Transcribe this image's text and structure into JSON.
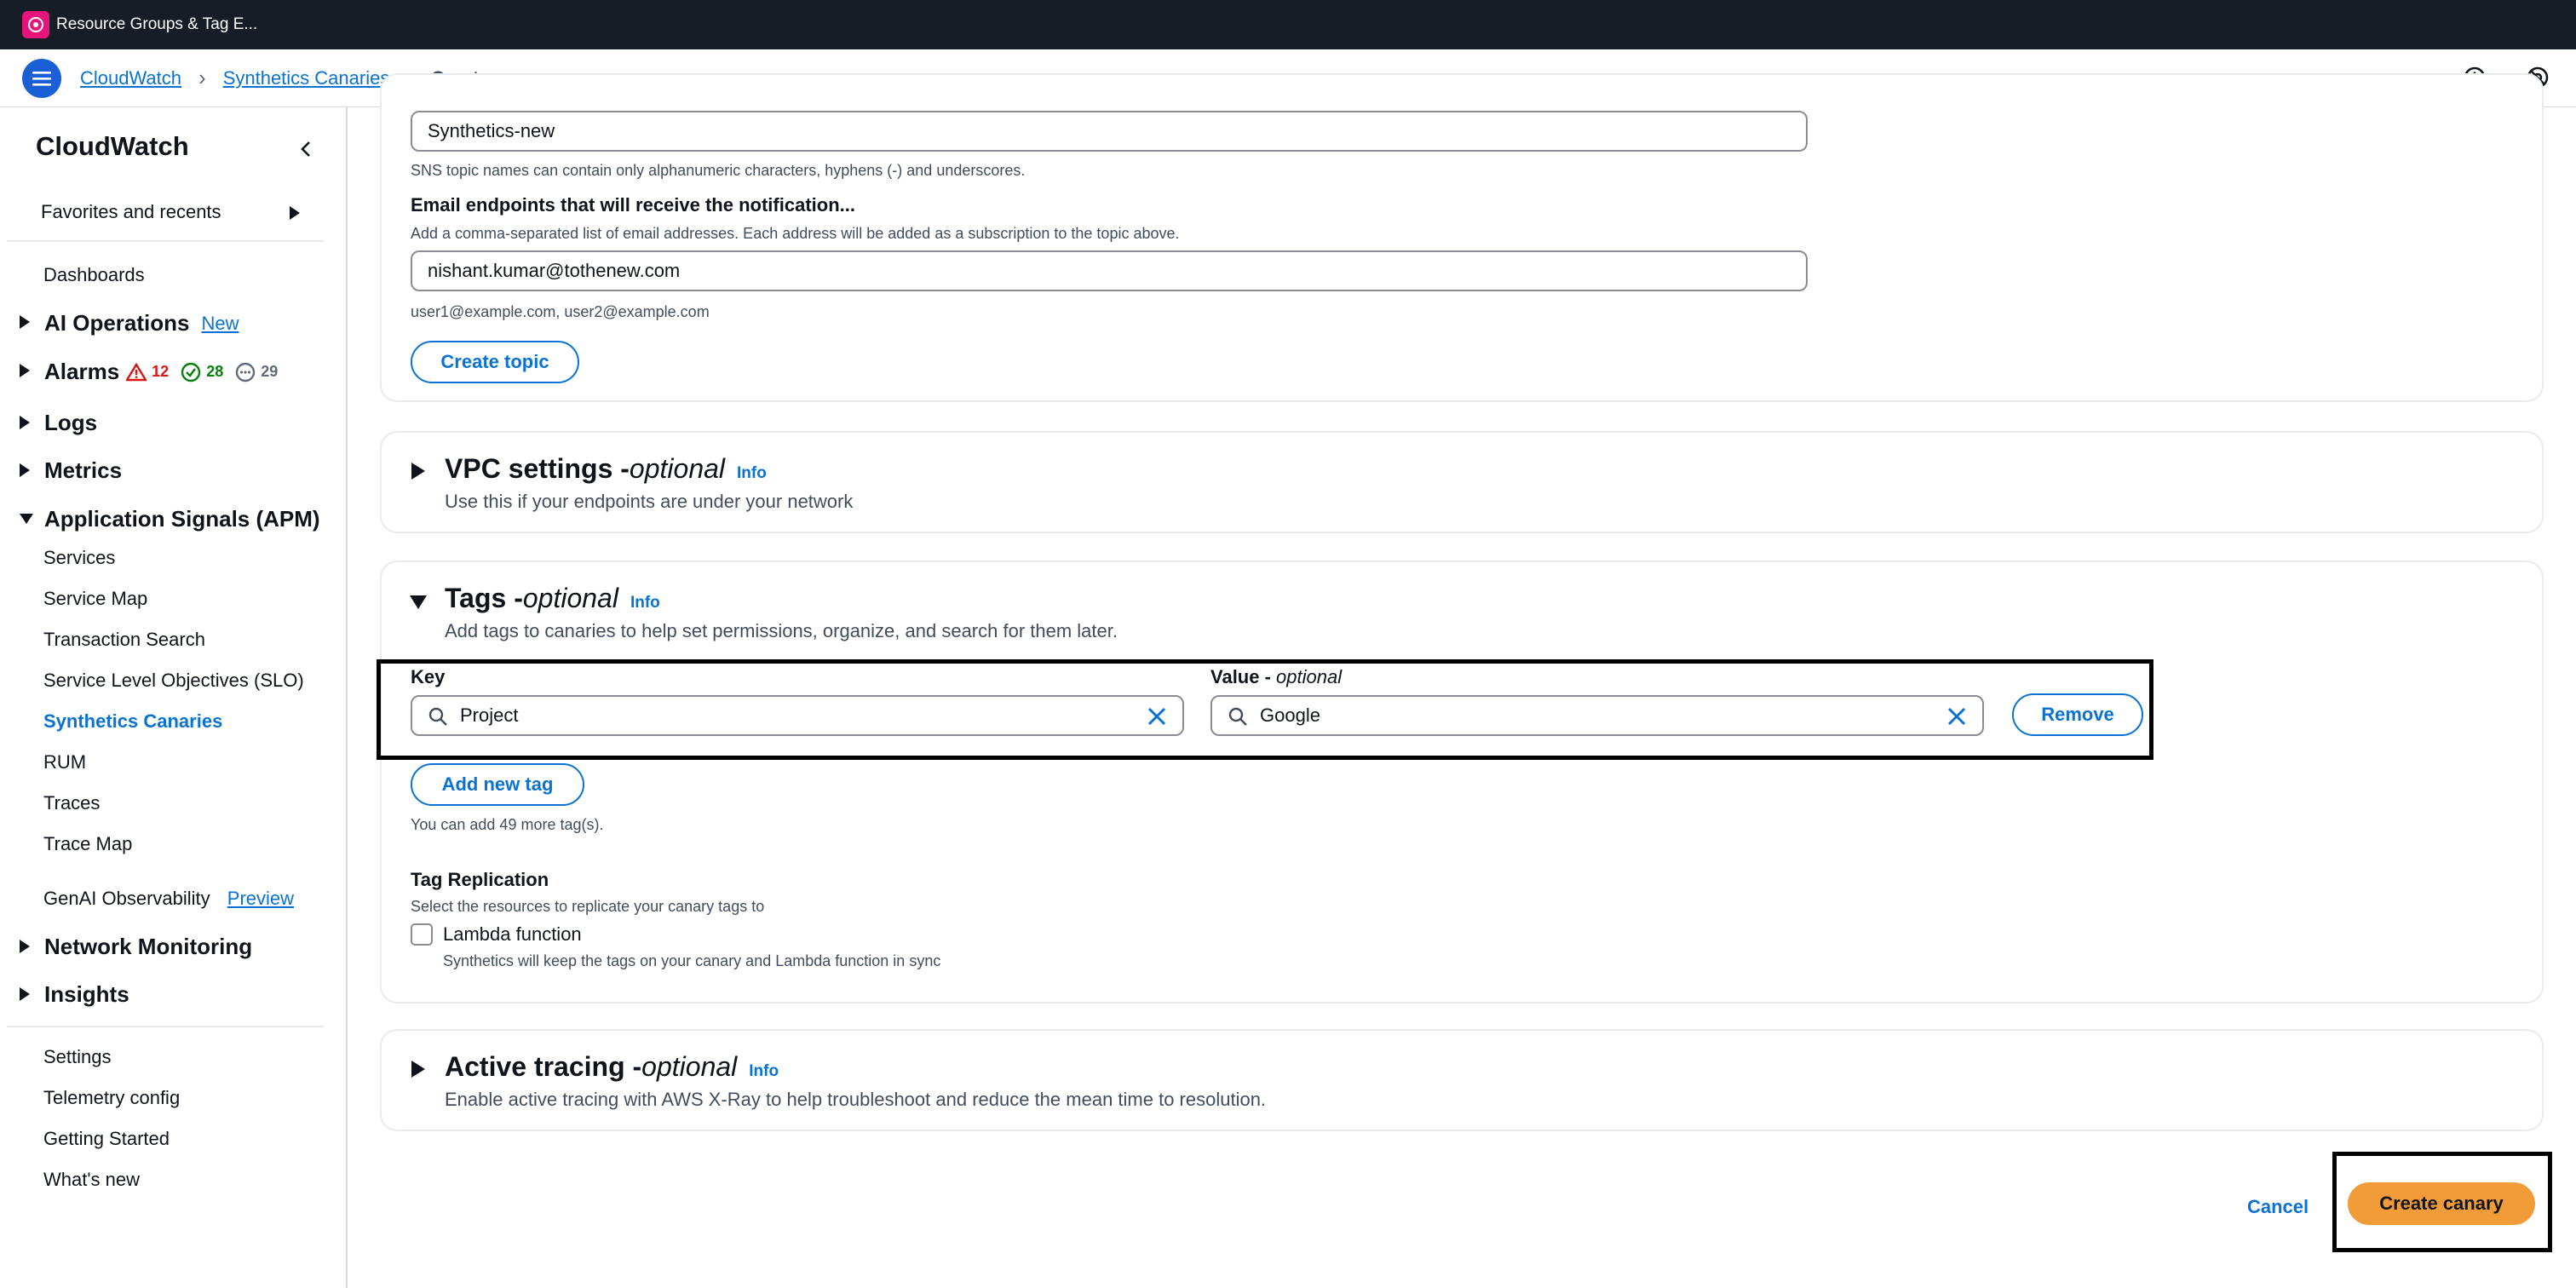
{
  "topbar": {
    "app_title": "Resource Groups & Tag E..."
  },
  "breadcrumb": {
    "items": [
      "CloudWatch",
      "Synthetics Canaries"
    ],
    "current": "Create a canary"
  },
  "sidebar": {
    "title": "CloudWatch",
    "favorites": "Favorites and recents",
    "dashboards": "Dashboards",
    "ai_operations": "AI Operations",
    "ai_badge": "New",
    "alarms": "Alarms",
    "alarm_counts": {
      "in_alarm": "12",
      "ok": "28",
      "insufficient": "29"
    },
    "logs": "Logs",
    "metrics": "Metrics",
    "app_signals": "Application Signals (APM)",
    "app_items": [
      "Services",
      "Service Map",
      "Transaction Search",
      "Service Level Objectives (SLO)",
      "Synthetics Canaries",
      "RUM",
      "Traces",
      "Trace Map"
    ],
    "genai": "GenAI Observability",
    "genai_badge": "Preview",
    "network": "Network Monitoring",
    "insights": "Insights",
    "footer_items": [
      "Settings",
      "Telemetry config",
      "Getting Started",
      "What's new"
    ]
  },
  "notification": {
    "topic_value": "Synthetics-new",
    "topic_helper": "SNS topic names can contain only alphanumeric characters, hyphens (-) and underscores.",
    "email_label": "Email endpoints that will receive the notification...",
    "email_desc": "Add a comma-separated list of email addresses. Each address will be added as a subscription to the topic above.",
    "email_value": "nishant.kumar@tothenew.com",
    "email_helper": "user1@example.com, user2@example.com",
    "create_topic": "Create topic"
  },
  "vpc": {
    "title": "VPC settings - ",
    "optional": "optional",
    "info": "Info",
    "desc": "Use this if your endpoints are under your network"
  },
  "tags": {
    "title": "Tags - ",
    "optional": "optional",
    "info": "Info",
    "desc": "Add tags to canaries to help set permissions, organize, and search for them later.",
    "key_label": "Key",
    "value_label": "Value - ",
    "value_optional": "optional",
    "key_value": "Project",
    "value_value": "Google",
    "remove": "Remove",
    "add_new": "Add new tag",
    "remaining": "You can add 49 more tag(s).",
    "replication_label": "Tag Replication",
    "replication_desc": "Select the resources to replicate your canary tags to",
    "lambda_label": "Lambda function",
    "lambda_desc": "Synthetics will keep the tags on your canary and Lambda function in sync"
  },
  "tracing": {
    "title": "Active tracing - ",
    "optional": "optional",
    "info": "Info",
    "desc": "Enable active tracing with AWS X-Ray to help troubleshoot and reduce the mean time to resolution."
  },
  "footer": {
    "cancel": "Cancel",
    "create": "Create canary"
  },
  "colors": {
    "link": "#0972d3",
    "primary": "#f19c38",
    "topbar": "#161d26"
  }
}
